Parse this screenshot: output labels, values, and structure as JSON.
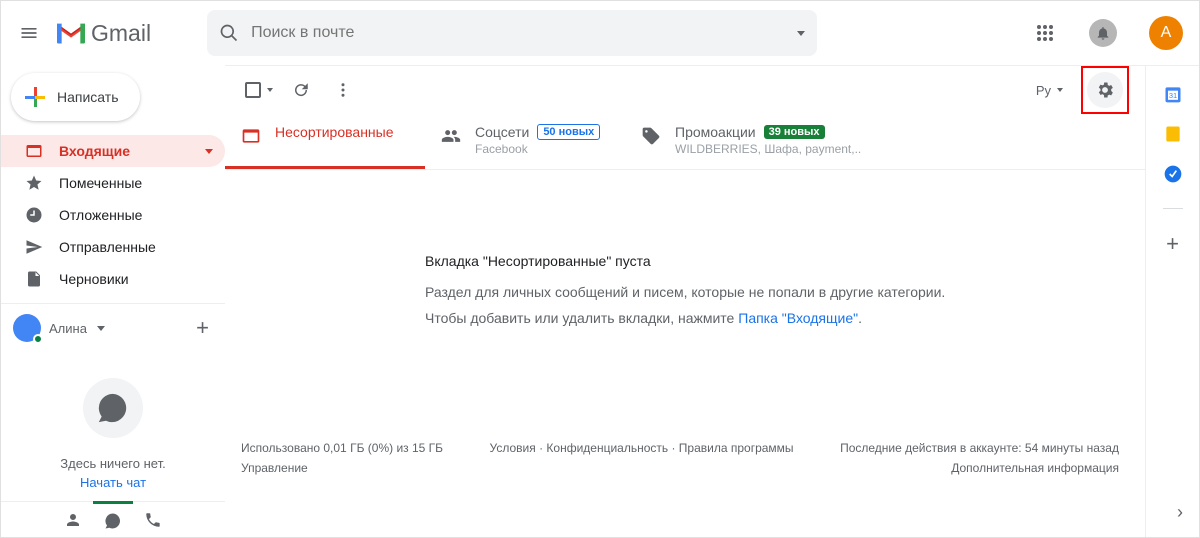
{
  "header": {
    "app_name": "Gmail",
    "search_placeholder": "Поиск в почте",
    "avatar_initial": "А"
  },
  "compose": {
    "label": "Написать"
  },
  "nav": {
    "inbox": "Входящие",
    "starred": "Помеченные",
    "snoozed": "Отложенные",
    "sent": "Отправленные",
    "drafts": "Черновики"
  },
  "hangouts": {
    "user": "Алина",
    "empty_line": "Здесь ничего нет.",
    "start_chat": "Начать чат"
  },
  "toolbar": {
    "lang": "Ру"
  },
  "tabs": {
    "primary": {
      "label": "Несортированные"
    },
    "social": {
      "label": "Соцсети",
      "badge": "50 новых",
      "sub": "Facebook"
    },
    "promo": {
      "label": "Промоакции",
      "badge": "39 новых",
      "sub": "WILDBERRIES, Шафа, payment,.."
    }
  },
  "empty": {
    "title": "Вкладка \"Несортированные\" пуста",
    "line1": "Раздел для личных сообщений и писем, которые не попали в другие категории.",
    "line2_prefix": "Чтобы добавить или удалить вкладки, нажмите ",
    "line2_link": "Папка \"Входящие\"",
    "line2_suffix": "."
  },
  "footer": {
    "storage_1": "Использовано 0,01 ГБ (0%) из 15 ГБ",
    "storage_2": "Управление",
    "links": "Условия · Конфиденциальность · Правила программы",
    "activity_1": "Последние действия в аккаунте: 54 минуты назад",
    "activity_2": "Дополнительная информация"
  }
}
